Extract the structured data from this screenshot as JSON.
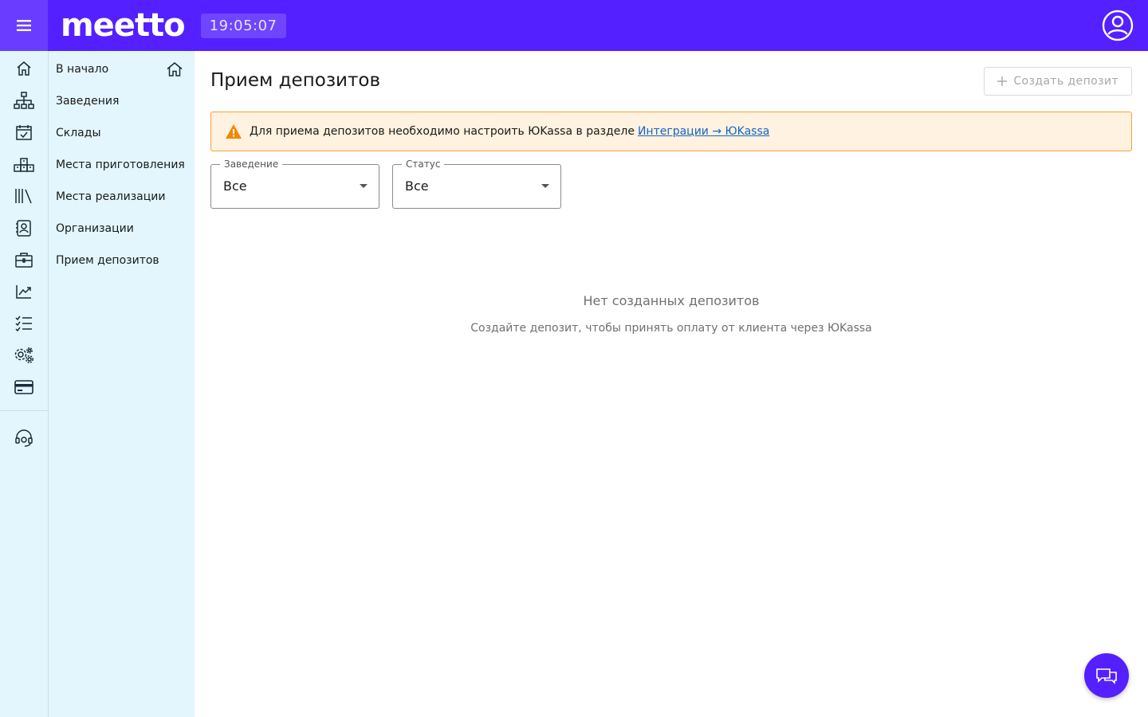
{
  "header": {
    "logo_text": "meetto",
    "clock": "19:05:07",
    "brand_color": "#5420ff"
  },
  "rail": {
    "items": [
      {
        "icon": "home-icon"
      },
      {
        "icon": "org-structure-icon"
      },
      {
        "icon": "calendar-check-icon"
      },
      {
        "icon": "warehouse-boxes-icon"
      },
      {
        "icon": "library-icon"
      },
      {
        "icon": "contact-card-icon"
      },
      {
        "icon": "briefcase-icon"
      },
      {
        "icon": "chart-icon"
      },
      {
        "icon": "checklist-icon"
      },
      {
        "icon": "settings-gears-icon"
      },
      {
        "icon": "credit-card-icon"
      }
    ],
    "support_icon": "support-headset-icon"
  },
  "submenu": {
    "items": [
      {
        "label": "В начало"
      },
      {
        "label": "Заведения"
      },
      {
        "label": "Склады"
      },
      {
        "label": "Места приготовления"
      },
      {
        "label": "Места реализации"
      },
      {
        "label": "Организации"
      },
      {
        "label": "Прием депозитов"
      }
    ]
  },
  "main": {
    "title": "Прием депозитов",
    "create_button": "Создать депозит",
    "alert": {
      "text": "Для приема депозитов необходимо настроить ЮKassa в разделе",
      "link": "Интеграции → ЮKassa"
    },
    "filters": {
      "venue": {
        "label": "Заведение",
        "value": "Все"
      },
      "status": {
        "label": "Статус",
        "value": "Все"
      }
    },
    "empty": {
      "title": "Нет созданных депозитов",
      "subtitle": "Создайте депозит, чтобы принять оплату от клиента через ЮKassa"
    }
  }
}
